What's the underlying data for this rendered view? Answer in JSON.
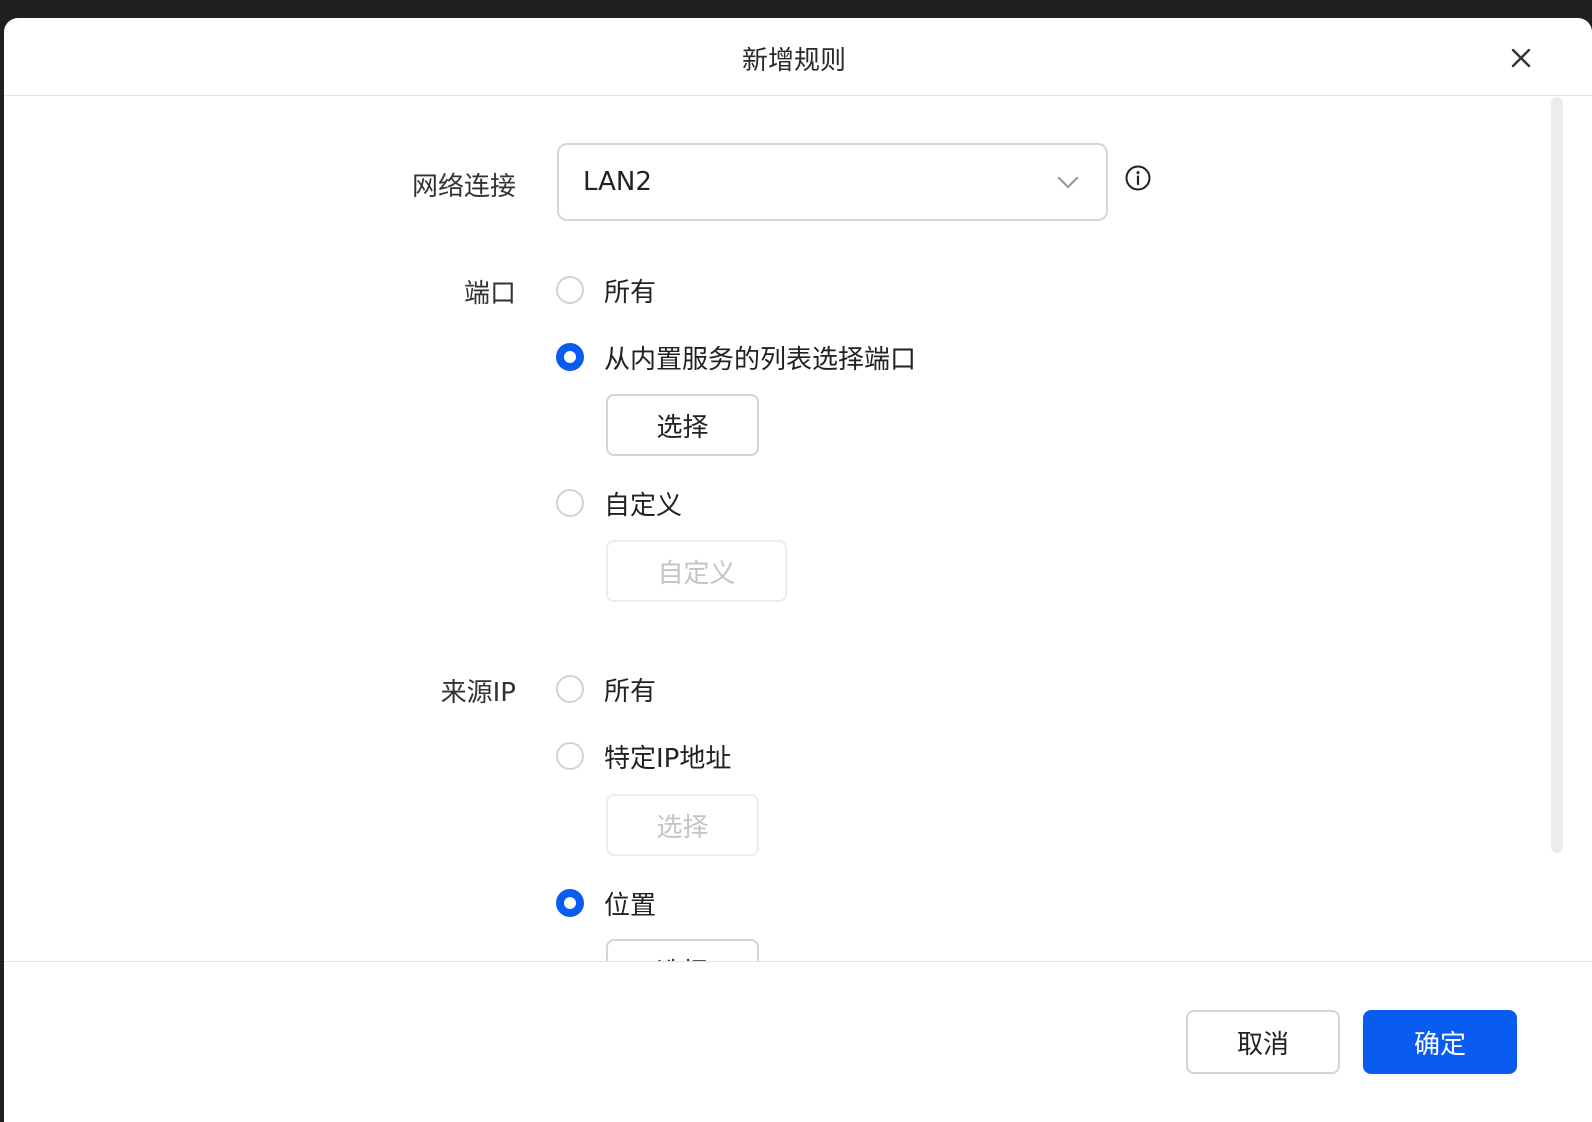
{
  "dialog": {
    "title": "新增规则"
  },
  "network": {
    "label": "网络连接",
    "value": "LAN2"
  },
  "port": {
    "label": "端口",
    "options": [
      {
        "label": "所有",
        "selected": false
      },
      {
        "label": "从内置服务的列表选择端口",
        "selected": true
      },
      {
        "label": "自定义",
        "selected": false
      }
    ],
    "select_button": "选择",
    "custom_button": "自定义"
  },
  "source_ip": {
    "label": "来源IP",
    "options": [
      {
        "label": "所有",
        "selected": false
      },
      {
        "label": "特定IP地址",
        "selected": false
      },
      {
        "label": "位置",
        "selected": true
      }
    ],
    "select_button": "选择",
    "location_button": "选择"
  },
  "footer": {
    "cancel": "取消",
    "ok": "确定"
  },
  "colors": {
    "accent": "#0a5cf0",
    "border": "#d4d4d4"
  },
  "icons": {
    "close": "close-icon",
    "dropdown": "chevron-down-icon",
    "info": "info-icon"
  }
}
